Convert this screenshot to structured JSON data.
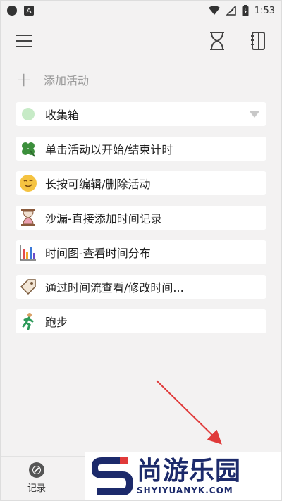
{
  "status": {
    "time": "1:53"
  },
  "add_activity": "添加活动",
  "items": [
    {
      "label": "收集箱",
      "icon": "green-dot-icon"
    },
    {
      "label": "单击活动以开始/结束计时",
      "icon": "clover-icon"
    },
    {
      "label": "长按可编辑/删除活动",
      "icon": "smile-icon"
    },
    {
      "label": "沙漏-直接添加时间记录",
      "icon": "hourglass-icon"
    },
    {
      "label": "时间图-查看时间分布",
      "icon": "bar-chart-icon"
    },
    {
      "label": "通过时间流查看/修改时间...",
      "icon": "tag-icon"
    },
    {
      "label": "跑步",
      "icon": "runner-icon"
    }
  ],
  "bottom_nav": {
    "record_label": "记录"
  },
  "watermark": {
    "cn": "尚游乐园",
    "en": "SHYIYUANYK.COM"
  },
  "colors": {
    "background": "#f3f2f2",
    "arrow": "#e03a3a",
    "brand": "#1c2a6b"
  }
}
